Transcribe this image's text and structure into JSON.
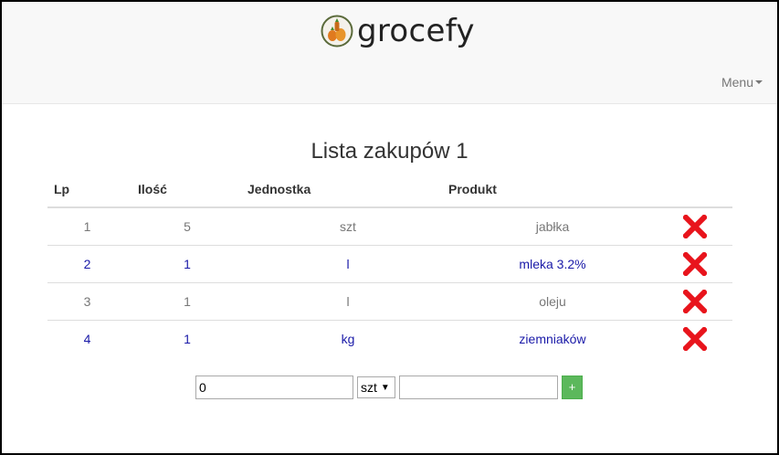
{
  "navbar": {
    "brand_name": "grocefy",
    "menu_label": "Menu"
  },
  "list": {
    "title": "Lista zakupów 1",
    "columns": {
      "lp": "Lp",
      "qty": "Ilość",
      "unit": "Jednostka",
      "product": "Produkt"
    },
    "rows": [
      {
        "lp": "1",
        "qty": "5",
        "unit": "szt",
        "product": "jabłka"
      },
      {
        "lp": "2",
        "qty": "1",
        "unit": "l",
        "product": "mleka 3.2%"
      },
      {
        "lp": "3",
        "qty": "1",
        "unit": "l",
        "product": "oleju"
      },
      {
        "lp": "4",
        "qty": "1",
        "unit": "kg",
        "product": "ziemniaków"
      }
    ],
    "delete_icon": "close-icon",
    "delete_color": "#e8141c"
  },
  "add_form": {
    "qty_value": "0",
    "unit_selected": "szt",
    "product_value": "",
    "add_label": "+"
  },
  "colors": {
    "add_button": "#5cb85c",
    "row_even_text": "#1a1aa8",
    "row_odd_text": "#777777"
  }
}
